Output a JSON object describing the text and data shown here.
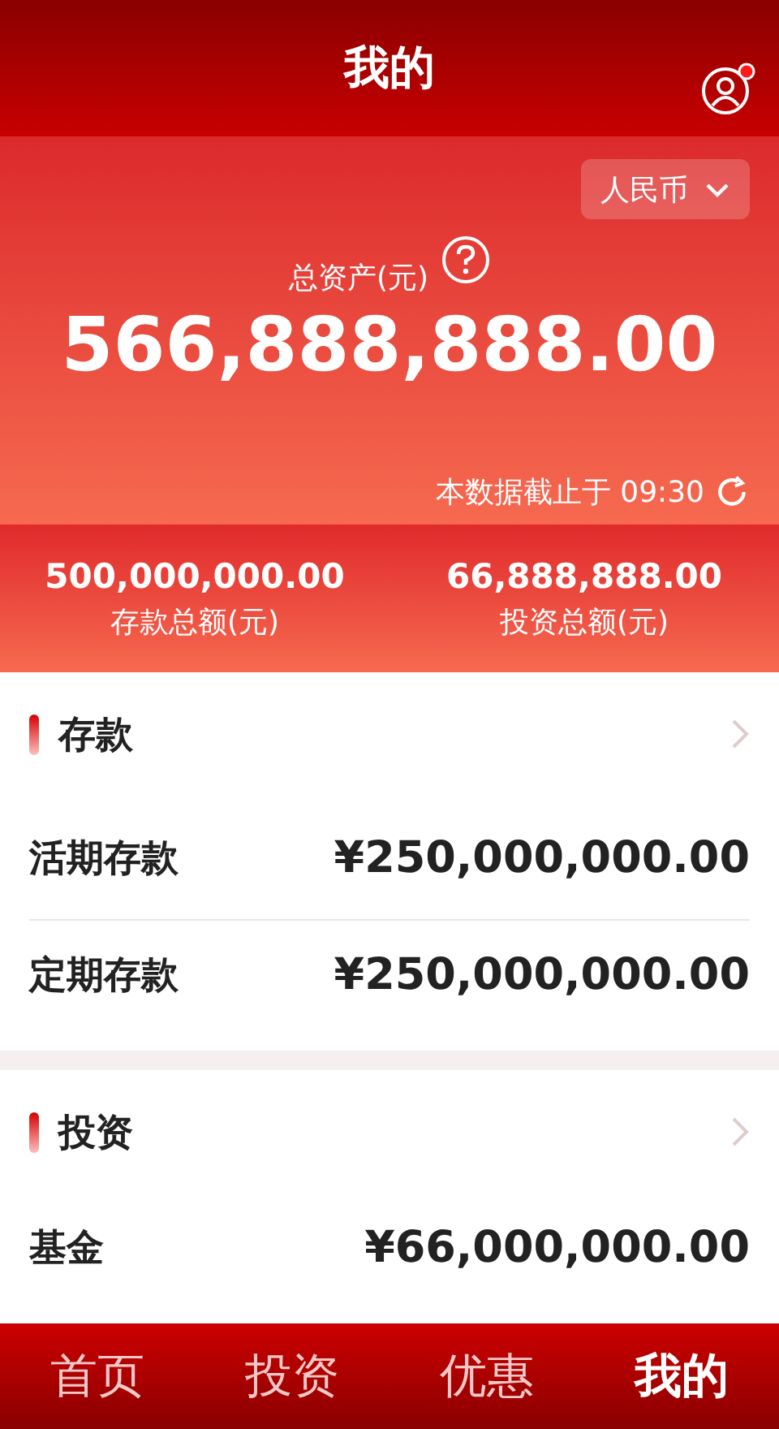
{
  "header": {
    "title": "我的",
    "profile_notification": true
  },
  "currency": {
    "label": "人民币"
  },
  "total": {
    "label": "总资产(元)",
    "amount": "566,888,888.00",
    "updated": "本数据截止于 09:30"
  },
  "summary": [
    {
      "amount": "500,000,000.00",
      "label": "存款总额(元)"
    },
    {
      "amount": "66,888,888.00",
      "label": "投资总额(元)"
    }
  ],
  "sections": [
    {
      "title": "存款",
      "rows": [
        {
          "name": "活期存款",
          "amount": "¥250,000,000.00"
        },
        {
          "name": "定期存款",
          "amount": "¥250,000,000.00"
        }
      ]
    },
    {
      "title": "投资",
      "rows": [
        {
          "name": "基金",
          "amount": "¥66,000,000.00"
        }
      ]
    }
  ],
  "tabs": [
    {
      "label": "首页",
      "selected": false
    },
    {
      "label": "投资",
      "selected": false
    },
    {
      "label": "优惠",
      "selected": false
    },
    {
      "label": "我的",
      "selected": true
    }
  ]
}
